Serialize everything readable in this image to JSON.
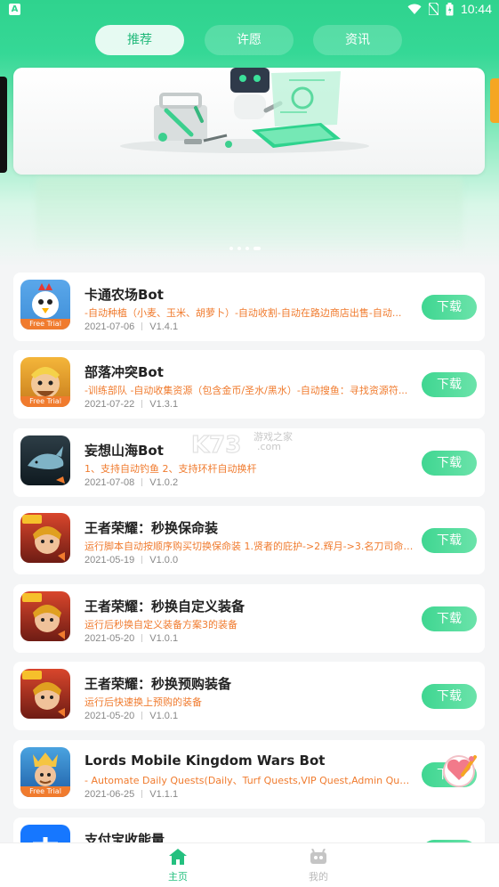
{
  "status_bar": {
    "time": "10:44",
    "app_letter": "A"
  },
  "tabs": [
    {
      "label": "推荐",
      "active": true
    },
    {
      "label": "许愿",
      "active": false
    },
    {
      "label": "资讯",
      "active": false
    }
  ],
  "banner": {
    "page_count": 4,
    "active_index": 3
  },
  "watermark": {
    "brand": "K73",
    "cn": "游戏之家",
    "domain": ".com"
  },
  "apps": [
    {
      "title": "卡通农场Bot",
      "desc": "-自动种植（小麦、玉米、胡萝卜）-自动收割-自动在路边商店出售-自动...",
      "date": "2021-07-06",
      "version": "V1.4.1",
      "button": "下载",
      "icon": "hay-day-chicken-icon",
      "badge": "Free Trial"
    },
    {
      "title": "部落冲突Bot",
      "desc": "-训练部队 -自动收集资源（包含金币/圣水/黑水）-自动搜鱼：寻找资源符...",
      "date": "2021-07-22",
      "version": "V1.3.1",
      "button": "下载",
      "icon": "clash-barbarian-icon",
      "badge": "Free Trial"
    },
    {
      "title": "妄想山海Bot",
      "desc": "1、支持自动钓鱼 2、支持环杆自动换杆",
      "date": "2021-07-08",
      "version": "V1.0.2",
      "button": "下载",
      "icon": "whale-icon",
      "badge": ""
    },
    {
      "title": "王者荣耀：秒换保命装",
      "desc": "运行脚本自动按顺序购买切换保命装 1.贤者的庇护->2.辉月->3.名刀司命->...",
      "date": "2021-05-19",
      "version": "V1.0.0",
      "button": "下载",
      "icon": "hok-hero-icon",
      "badge": ""
    },
    {
      "title": "王者荣耀：秒换自定义装备",
      "desc": "运行后秒换自定义装备方案3的装备",
      "date": "2021-05-20",
      "version": "V1.0.1",
      "button": "下载",
      "icon": "hok-hero-icon",
      "badge": ""
    },
    {
      "title": "王者荣耀：秒换预购装备",
      "desc": "运行后快速换上预购的装备",
      "date": "2021-05-20",
      "version": "V1.0.1",
      "button": "下载",
      "icon": "hok-hero-icon",
      "badge": ""
    },
    {
      "title": "Lords Mobile Kingdom Wars Bot",
      "desc": "- Automate Daily Quests(Daily、Turf Quests,VIP Quest,Admin Quests,Guild...",
      "date": "2021-06-25",
      "version": "V1.1.1",
      "button": "下载",
      "icon": "lords-mobile-knight-icon",
      "badge": "Free Trial"
    },
    {
      "title": "支付宝收能量",
      "desc": "",
      "date": "",
      "version": "",
      "button": "下载",
      "icon": "alipay-icon",
      "badge": ""
    }
  ],
  "bottom_nav": [
    {
      "label": "主页",
      "icon": "home-icon",
      "active": true
    },
    {
      "label": "我的",
      "icon": "robot-icon",
      "active": false
    }
  ],
  "colors": {
    "primary": "#2fd38e",
    "accent": "#f07b2e",
    "card_bg": "#ffffff"
  }
}
